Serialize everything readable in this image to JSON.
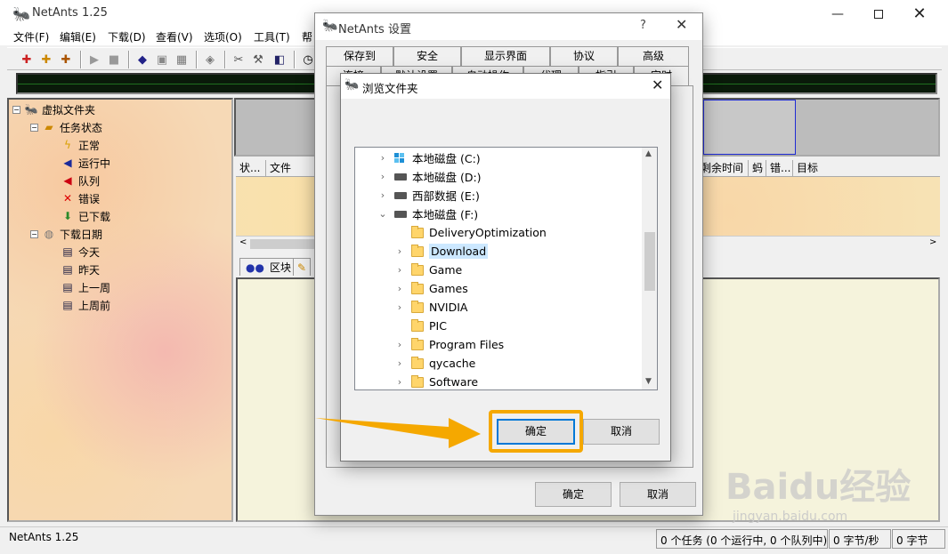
{
  "app": {
    "title": "NetAnts 1.25",
    "window_controls": [
      "minimize",
      "maximize",
      "close"
    ]
  },
  "menu": [
    "文件(F)",
    "编辑(E)",
    "下载(D)",
    "查看(V)",
    "选项(O)",
    "工具(T)",
    "帮"
  ],
  "tree": {
    "root": "虚拟文件夹",
    "status_group": "任务状态",
    "status_items": [
      "正常",
      "运行中",
      "队列",
      "错误",
      "已下载"
    ],
    "date_group": "下载日期",
    "date_items": [
      "今天",
      "昨天",
      "上一周",
      "上周前"
    ]
  },
  "list_columns": [
    "状...",
    "文件",
    "剩余时间",
    "蚂",
    "错...",
    "目标"
  ],
  "bottom_tabs": {
    "blocks": "区块"
  },
  "status_bar": {
    "app": "NetAnts 1.25",
    "tasks": "0 个任务 (0 个运行中, 0 个队列中)",
    "speed": "0 字节/秒",
    "bytes": "0 字节"
  },
  "settings_dialog": {
    "title": "NetAnts 设置",
    "help": "?",
    "tabs_row1": [
      "保存到",
      "安全",
      "显示界面",
      "协议",
      "高级"
    ],
    "tabs_row2": [
      "连接",
      "默认设置",
      "自动操作",
      "代理",
      "指引",
      "定时"
    ],
    "ok": "确定",
    "cancel": "取消"
  },
  "browse_dialog": {
    "title": "浏览文件夹",
    "ok": "确定",
    "cancel": "取消",
    "drives": [
      {
        "label": "本地磁盘 (C:)",
        "icon": "system-drive-icon"
      },
      {
        "label": "本地磁盘 (D:)",
        "icon": "drive-icon"
      },
      {
        "label": "西部数据 (E:)",
        "icon": "drive-icon"
      },
      {
        "label": "本地磁盘 (F:)",
        "icon": "drive-icon"
      }
    ],
    "folders": [
      "DeliveryOptimization",
      "Download",
      "Game",
      "Games",
      "NVIDIA",
      "PIC",
      "Program Files",
      "qycache",
      "Software"
    ],
    "selected_folder": "Download"
  },
  "annotation": {
    "highlight_color": "#f5a800"
  },
  "watermark": {
    "text": "Baidu经验",
    "sub": "jingyan.baidu.com"
  }
}
